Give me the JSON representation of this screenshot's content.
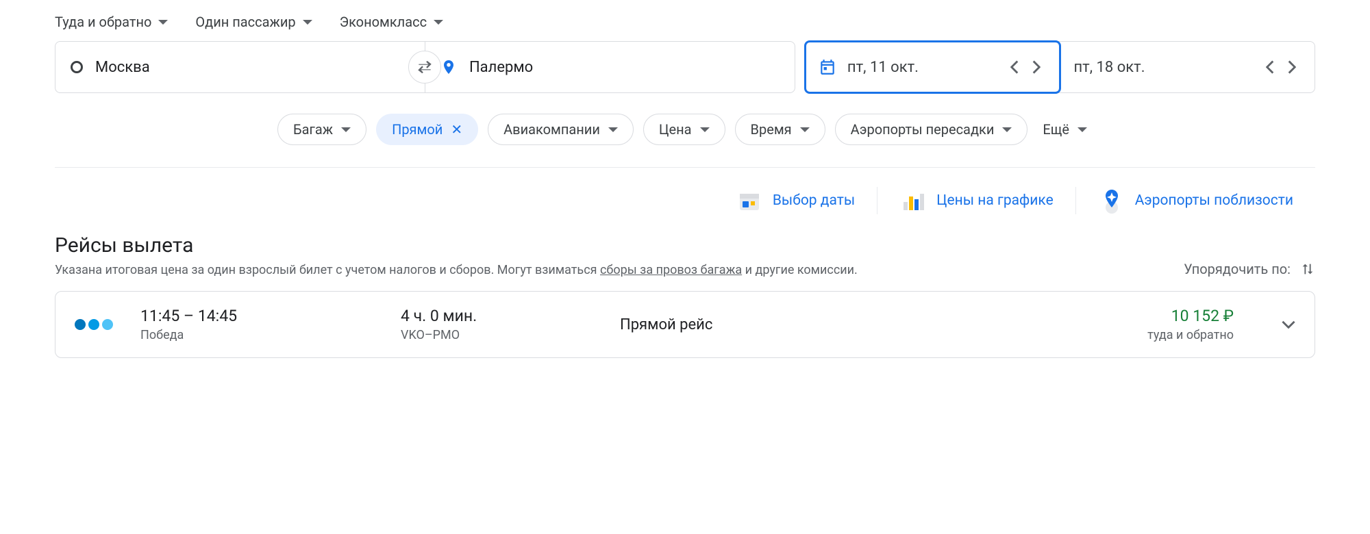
{
  "trip": {
    "type_label": "Туда и обратно",
    "passengers_label": "Один пассажир",
    "cabin_label": "Экономкласс"
  },
  "search": {
    "origin": "Москва",
    "destination": "Палермо",
    "depart_date": "пт, 11 окт.",
    "return_date": "пт, 18 окт."
  },
  "filters": {
    "bags": "Багаж",
    "stops": "Прямой",
    "airlines": "Авиакомпании",
    "price": "Цена",
    "time": "Время",
    "connecting_airports": "Аэропорты пересадки",
    "more": "Ещё"
  },
  "helpers": {
    "date_grid": "Выбор даты",
    "price_graph": "Цены на графике",
    "nearby_airports": "Аэропорты поблизости"
  },
  "results": {
    "title": "Рейсы вылета",
    "subtitle_a": "Указана итоговая цена за один взрослый билет с учетом налогов и сборов. Могут взиматься ",
    "subtitle_link": "сборы за провоз багажа",
    "subtitle_b": " и другие комиссии.",
    "sort_label": "Упорядочить по:"
  },
  "flight": {
    "dep_time": "11:45",
    "arr_time": "14:45",
    "sep": "–",
    "airline": "Победа",
    "duration": "4 ч. 0 мин.",
    "route": "VKO–PMO",
    "stops": "Прямой рейс",
    "price": "10 152 ₽",
    "trip_type": "туда и обратно",
    "dot_colors": [
      "#0277bd",
      "#039be5",
      "#4fc3f7"
    ]
  }
}
